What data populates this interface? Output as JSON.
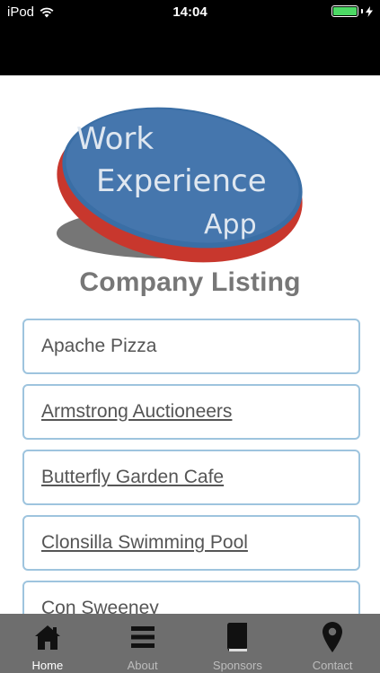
{
  "status_bar": {
    "carrier": "iPod",
    "time": "14:04"
  },
  "logo": {
    "line1": "Work",
    "line2": "Experience",
    "line3": "App"
  },
  "page_title": "Company Listing",
  "companies": [
    {
      "name": "Apache Pizza",
      "link": false
    },
    {
      "name": "Armstrong Auctioneers",
      "link": true
    },
    {
      "name": "Butterfly Garden Cafe",
      "link": true
    },
    {
      "name": "Clonsilla Swimming Pool",
      "link": true
    },
    {
      "name": "Con Sweeney",
      "link": false
    }
  ],
  "tabs": [
    {
      "label": "Home",
      "icon": "home-icon",
      "active": true
    },
    {
      "label": "About",
      "icon": "menu-icon",
      "active": false
    },
    {
      "label": "Sponsors",
      "icon": "book-icon",
      "active": false
    },
    {
      "label": "Contact",
      "icon": "location-pin-icon",
      "active": false
    }
  ],
  "colors": {
    "logo_blue": "#3a6ea5",
    "logo_red": "#c8372d",
    "list_border": "#9ec4de",
    "tab_bar": "#6e6e6e"
  }
}
